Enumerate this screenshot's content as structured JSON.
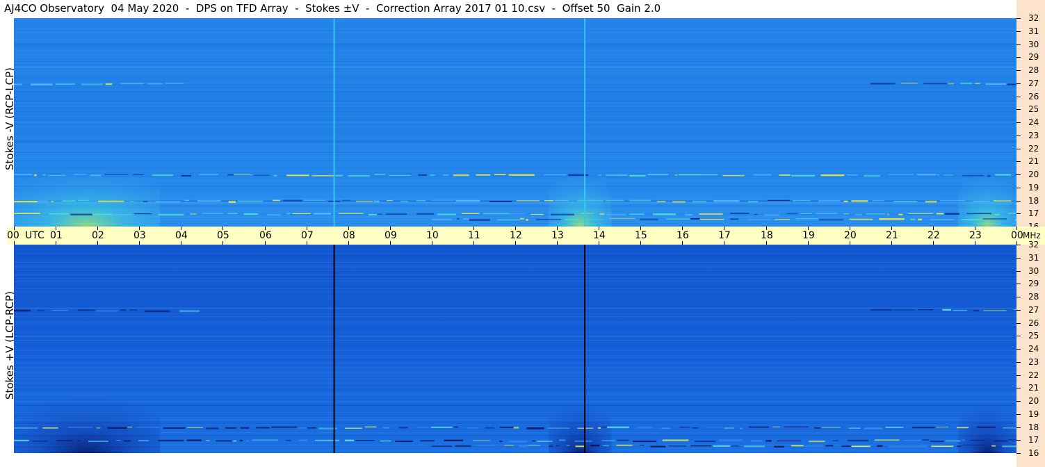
{
  "title": "AJ4CO Observatory  04 May 2020  -  DPS on TFD Array  -  Stokes ±V  -  Correction Array 2017 01 10.csv  -  Offset 50  Gain 2.0",
  "colors": {
    "frequency_axis_bg": "#fde3cc",
    "time_axis_bg": "#ffffc4",
    "top_panel_base": "#1e7fe6",
    "bottom_panel_base": "#155fd8",
    "top_gap_line": "#35c8e8",
    "bottom_gap_line": "#000000",
    "hot_yellow": "#f2ea3c",
    "cold_navy": "#071a6a"
  },
  "chart_data": [
    {
      "type": "heatmap",
      "panel": "top",
      "ylabel": "Stokes -V (RCP-LCP)",
      "x_unit": "UTC",
      "y_unit": "MHz",
      "xlim": [
        0,
        24
      ],
      "ylim": [
        16,
        32
      ],
      "yticks": [
        "32",
        "31",
        "30",
        "29",
        "28",
        "27",
        "26",
        "25",
        "24",
        "23",
        "22",
        "21",
        "20",
        "19",
        "18",
        "17",
        "16"
      ],
      "data_gaps_utc": [
        7.65,
        13.65
      ],
      "features": [
        {
          "kind": "daytime-enhancement",
          "start_utc": 0.0,
          "end_utc": 3.5,
          "fmin": 16.0,
          "fmax": 21.5
        },
        {
          "kind": "daytime-enhancement",
          "start_utc": 12.8,
          "end_utc": 14.3,
          "fmin": 16.0,
          "fmax": 21.0
        },
        {
          "kind": "daytime-enhancement",
          "start_utc": 22.6,
          "end_utc": 24.0,
          "fmin": 16.0,
          "fmax": 21.0
        },
        {
          "kind": "rfi-band",
          "freq": 27.0,
          "start_utc": 0.0,
          "end_utc": 4.0
        },
        {
          "kind": "rfi-band",
          "freq": 27.0,
          "start_utc": 20.5,
          "end_utc": 24.0
        },
        {
          "kind": "rfi-band",
          "freq": 17.0,
          "start_utc": 0.0,
          "end_utc": 24.0
        },
        {
          "kind": "rfi-band",
          "freq": 16.6,
          "start_utc": 10.0,
          "end_utc": 24.0
        },
        {
          "kind": "rfi-band",
          "freq": 20.0,
          "start_utc": 0.0,
          "end_utc": 24.0
        },
        {
          "kind": "rfi-band",
          "freq": 18.0,
          "start_utc": 0.0,
          "end_utc": 24.0
        }
      ]
    },
    {
      "type": "heatmap",
      "panel": "bottom",
      "ylabel": "Stokes +V  (LCP-RCP)",
      "x_unit": "UTC",
      "y_unit": "MHz",
      "xlim": [
        0,
        24
      ],
      "ylim": [
        16,
        32
      ],
      "yticks": [
        "32",
        "31",
        "30",
        "29",
        "28",
        "27",
        "26",
        "25",
        "24",
        "23",
        "22",
        "21",
        "20",
        "19",
        "18",
        "17",
        "16"
      ],
      "data_gaps_utc": [
        7.65,
        13.65
      ],
      "features": [
        {
          "kind": "daytime-depression",
          "start_utc": 0.0,
          "end_utc": 3.5,
          "fmin": 16.0,
          "fmax": 21.5
        },
        {
          "kind": "daytime-depression",
          "start_utc": 12.8,
          "end_utc": 14.3,
          "fmin": 16.0,
          "fmax": 21.0
        },
        {
          "kind": "daytime-depression",
          "start_utc": 22.6,
          "end_utc": 24.0,
          "fmin": 16.0,
          "fmax": 21.0
        },
        {
          "kind": "rfi-band",
          "freq": 27.0,
          "start_utc": 0.0,
          "end_utc": 4.0
        },
        {
          "kind": "rfi-band",
          "freq": 27.0,
          "start_utc": 20.5,
          "end_utc": 24.0
        },
        {
          "kind": "rfi-band",
          "freq": 17.0,
          "start_utc": 0.0,
          "end_utc": 24.0
        },
        {
          "kind": "rfi-band",
          "freq": 16.6,
          "start_utc": 10.0,
          "end_utc": 24.0
        },
        {
          "kind": "rfi-band",
          "freq": 18.0,
          "start_utc": 0.0,
          "end_utc": 24.0
        }
      ]
    }
  ],
  "time_axis": {
    "ticks": [
      "00",
      "01",
      "02",
      "03",
      "04",
      "05",
      "06",
      "07",
      "08",
      "09",
      "10",
      "11",
      "12",
      "13",
      "14",
      "15",
      "16",
      "17",
      "18",
      "19",
      "20",
      "21",
      "22",
      "23",
      "00"
    ],
    "utc_label": "UTC",
    "mhz_label": "MHz"
  }
}
